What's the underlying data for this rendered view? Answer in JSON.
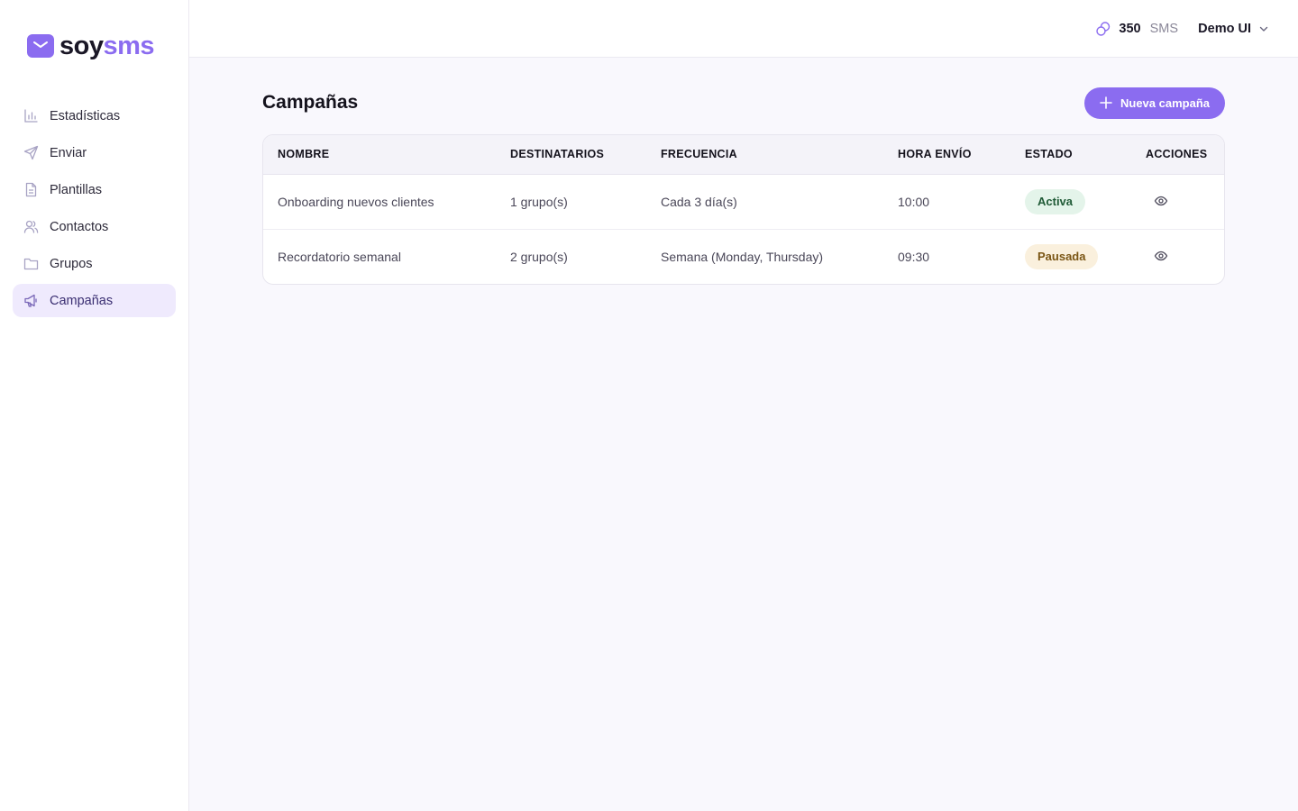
{
  "brand": {
    "name_part1": "soy",
    "name_part2": "sms",
    "accent": "#8b6cf0"
  },
  "sidebar": {
    "items": [
      {
        "label": "Estadísticas",
        "icon": "bar-chart-icon",
        "active": false
      },
      {
        "label": "Enviar",
        "icon": "send-icon",
        "active": false
      },
      {
        "label": "Plantillas",
        "icon": "document-icon",
        "active": false
      },
      {
        "label": "Contactos",
        "icon": "users-icon",
        "active": false
      },
      {
        "label": "Grupos",
        "icon": "folder-icon",
        "active": false
      },
      {
        "label": "Campañas",
        "icon": "megaphone-icon",
        "active": true
      }
    ]
  },
  "header": {
    "credits_value": "350",
    "credits_unit": "SMS",
    "credits_icon": "coins-icon",
    "user_name": "Demo UI"
  },
  "main": {
    "title": "Campañas",
    "new_button_label": "Nueva campaña",
    "columns": [
      "NOMBRE",
      "DESTINATARIOS",
      "FRECUENCIA",
      "HORA ENVÍO",
      "ESTADO",
      "ACCIONES"
    ],
    "rows": [
      {
        "name": "Onboarding nuevos clientes",
        "recipients": "1 grupo(s)",
        "frequency": "Cada 3 día(s)",
        "time": "10:00",
        "status": "Activa",
        "status_color": "#e4f4ea"
      },
      {
        "name": "Recordatorio semanal",
        "recipients": "2 grupo(s)",
        "frequency": "Semana (Monday, Thursday)",
        "time": "09:30",
        "status": "Pausada",
        "status_color": "#faf0dd"
      }
    ]
  }
}
